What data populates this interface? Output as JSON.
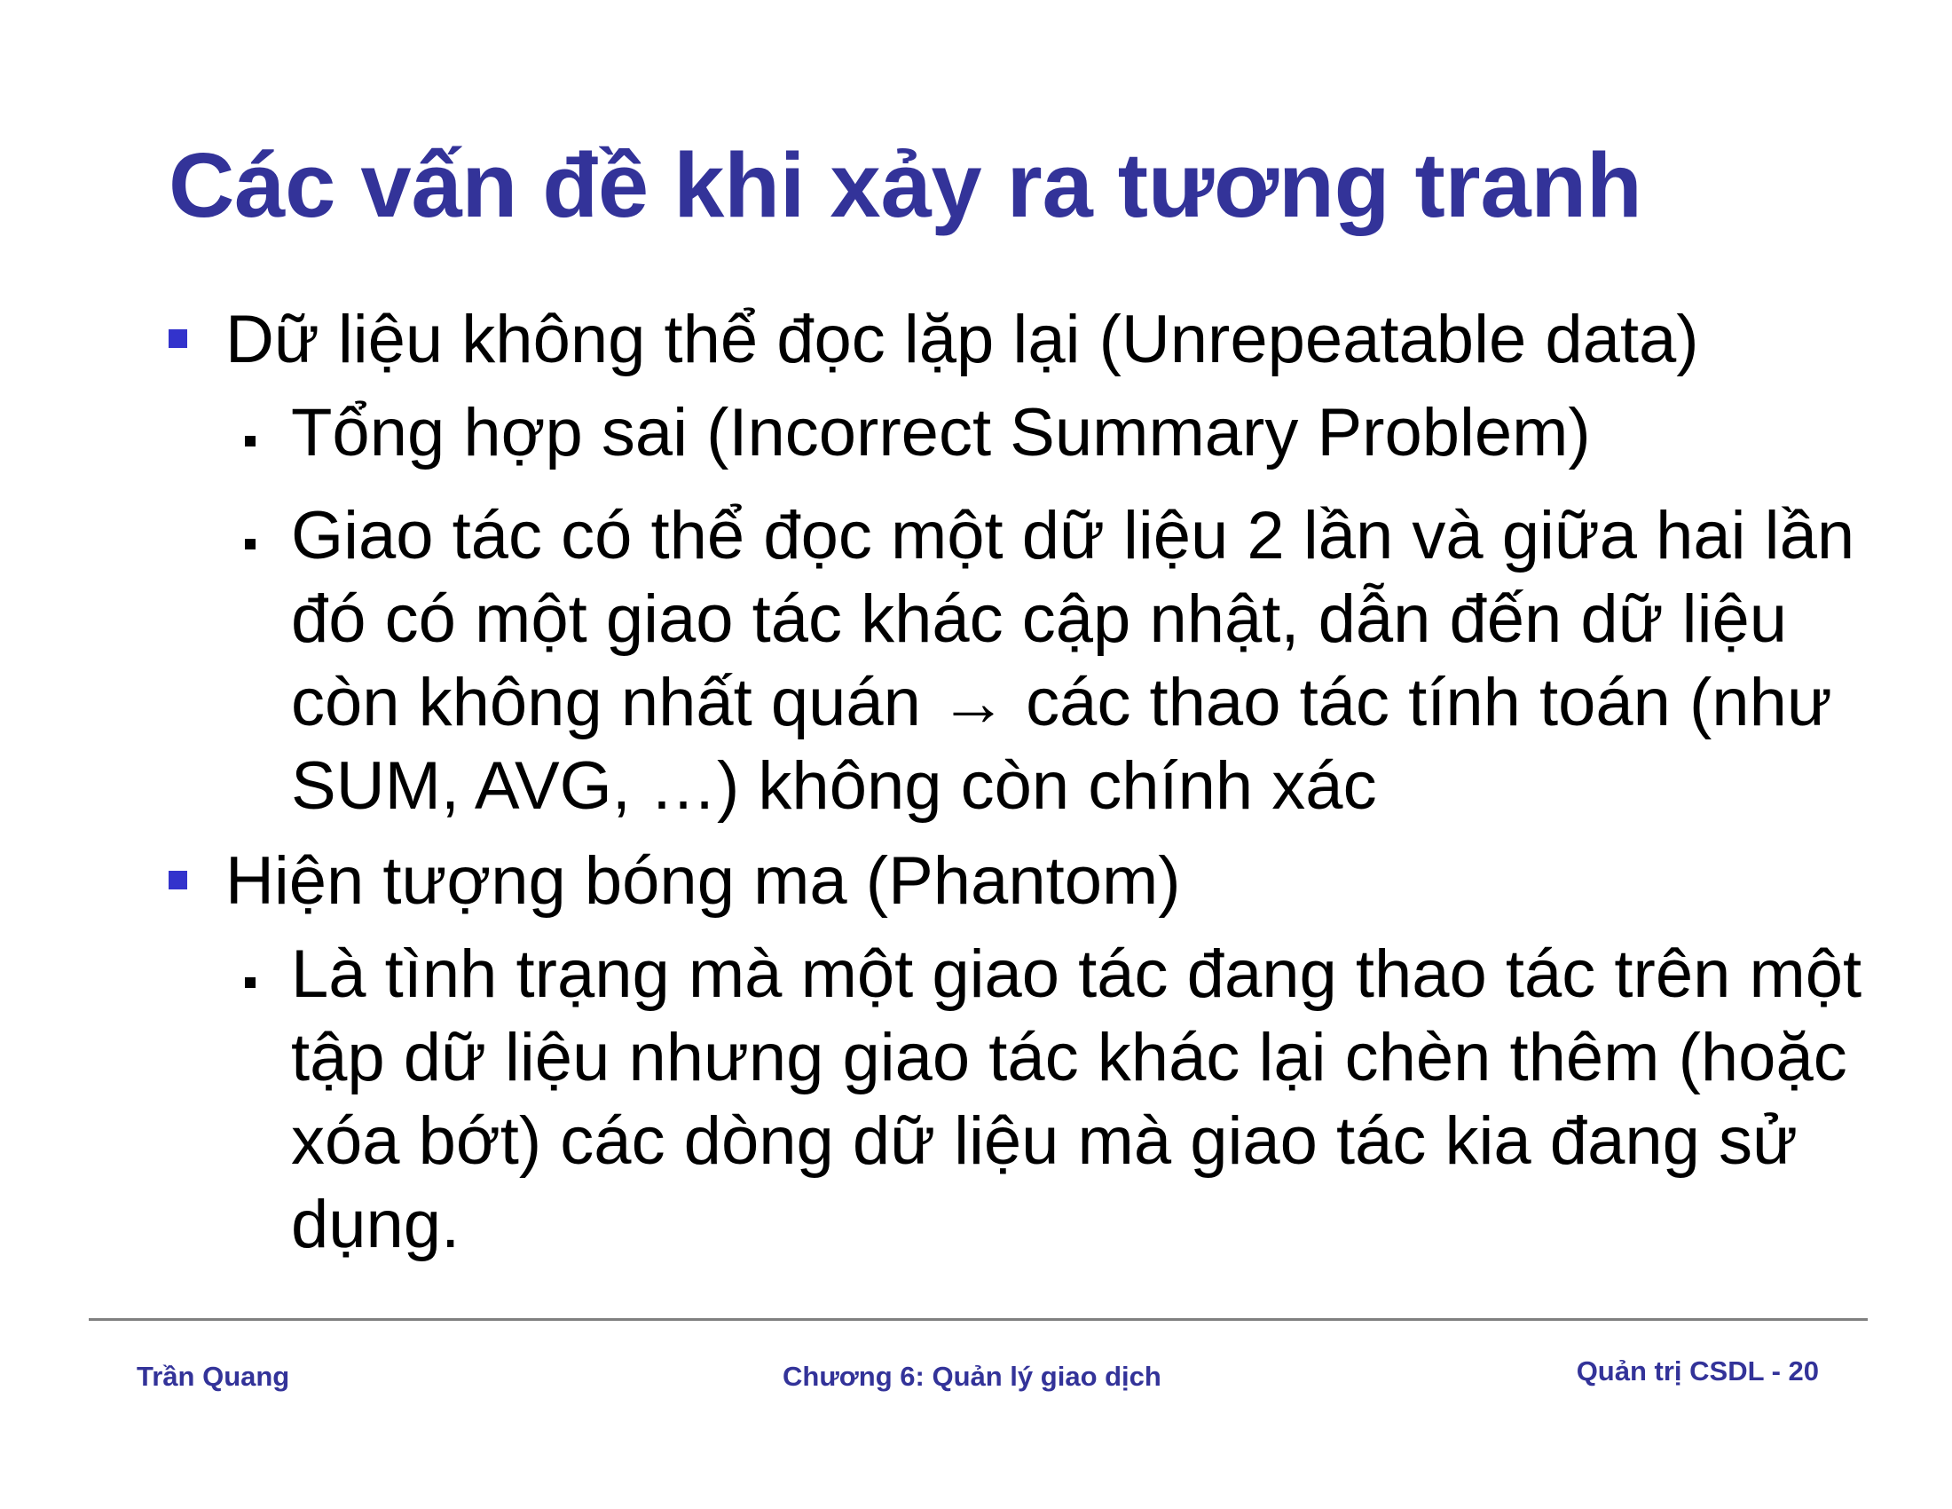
{
  "colors": {
    "title": "#333399",
    "bullet_level1": "#3333cc",
    "footer_text": "#333399",
    "footer_rule": "#808080"
  },
  "slide": {
    "title": "Các vấn đề khi xảy ra tương tranh",
    "items": [
      {
        "text": "Dữ liệu không thể đọc lặp lại (Unrepeatable data)",
        "subitems": [
          "Tổng hợp sai (Incorrect Summary Problem)",
          "Giao tác có thể đọc một dữ liệu 2 lần và giữa hai lần đó có một giao tác khác cập nhật, dẫn đến dữ liệu còn không nhất quán → các thao tác tính toán (như SUM, AVG, …) không còn chính xác"
        ]
      },
      {
        "text": "Hiện tượng bóng ma (Phantom)",
        "subitems": [
          "Là tình trạng mà một giao tác đang thao tác trên một tập dữ liệu nhưng giao tác khác lại chèn thêm (hoặc xóa bớt) các dòng dữ liệu mà giao tác kia đang sử dụng."
        ]
      }
    ]
  },
  "footer": {
    "author": "Trần Quang",
    "chapter": "Chương 6: Quản lý giao dịch",
    "page_label": "Quản trị CSDL - 20"
  }
}
